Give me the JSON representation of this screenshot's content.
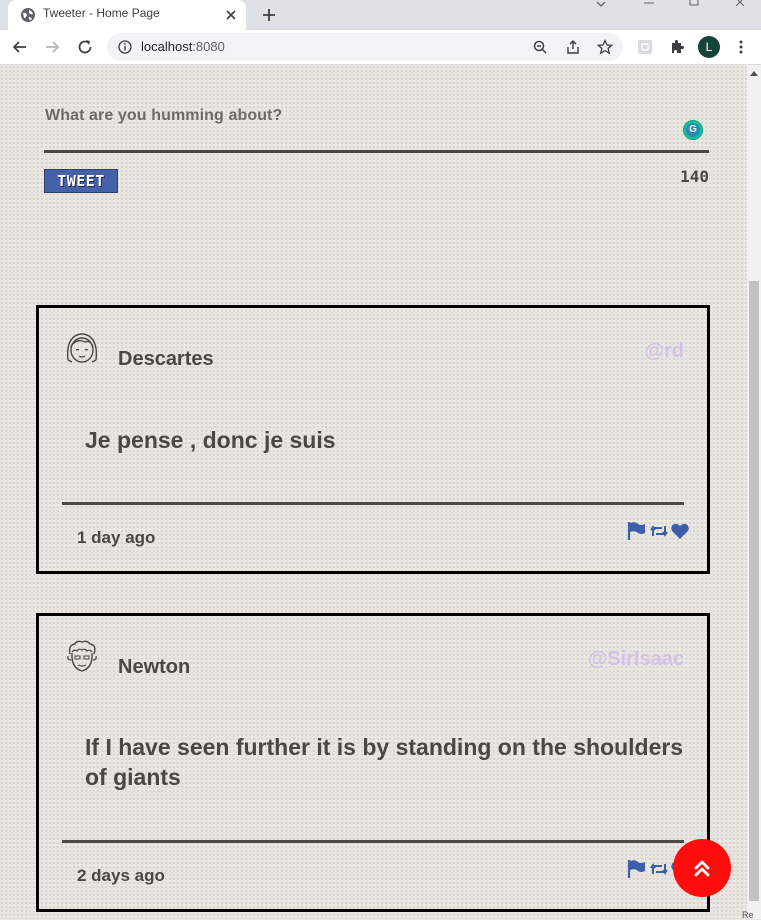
{
  "browser": {
    "tab_title": "Tweeter - Home Page",
    "url_host": "localhost",
    "url_port": ":8080",
    "profile_initial": "L"
  },
  "compose": {
    "placeholder": "What are you humming about?",
    "grammarly_label": "G",
    "button_label": "TWEET",
    "counter": "140"
  },
  "tweets": [
    {
      "name": "Descartes",
      "handle": "@rd",
      "text": "Je pense , donc je suis",
      "time": "1 day ago"
    },
    {
      "name": "Newton",
      "handle": "@SirIsaac",
      "text": "If I have seen further it is by standing on the shoulders of giants",
      "time": "2 days ago"
    }
  ],
  "corner_text": "Re",
  "icons": {
    "flag": "flag-icon",
    "retweet": "retweet-icon",
    "like": "heart-icon",
    "scroll_top": "double-chevron-up-icon"
  },
  "colors": {
    "accent": "#4562a8",
    "handle": "#d4c0e8",
    "text": "#4b4744",
    "scroll_top_button": "#ff0d0d"
  }
}
